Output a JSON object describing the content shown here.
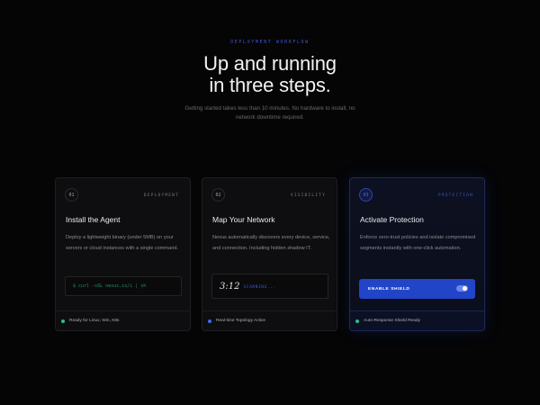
{
  "header": {
    "eyebrow": "DEPLOYMENT WORKFLOW",
    "title_line1": "Up and running",
    "title_line2": "in three steps.",
    "subtitle": "Getting started takes less than 10 minutes. No hardware to install, no network downtime required."
  },
  "steps": [
    {
      "number": "01",
      "category": "DEPLOYMENT",
      "title": "Install the Agent",
      "description": "Deploy a lightweight binary (under 5MB) on your servers or cloud instances with a single command.",
      "code": "$ curl -sSL nexus.io/i | sh",
      "footer": "Ready for Linux, Win, K8s",
      "status_color": "#2fbf84"
    },
    {
      "number": "02",
      "category": "VISIBILITY",
      "title": "Map Your Network",
      "description": "Nexus automatically discovers every device, service, and connection. Including hidden shadow IT.",
      "scan_time": "3:12",
      "scan_label": "SCANNING...",
      "footer": "Real-time Topology Active",
      "status_color": "#3d6cf0"
    },
    {
      "number": "03",
      "category": "PROTECTION",
      "title": "Activate Protection",
      "description": "Enforce zero-trust policies and isolate compromised segments instantly with one-click automation.",
      "button_label": "ENABLE SHIELD",
      "toggle_on": true,
      "footer": "Auto-Response Shield Ready",
      "status_color": "#2fbf84"
    }
  ],
  "colors": {
    "accent": "#2245c8",
    "background": "#050506"
  }
}
